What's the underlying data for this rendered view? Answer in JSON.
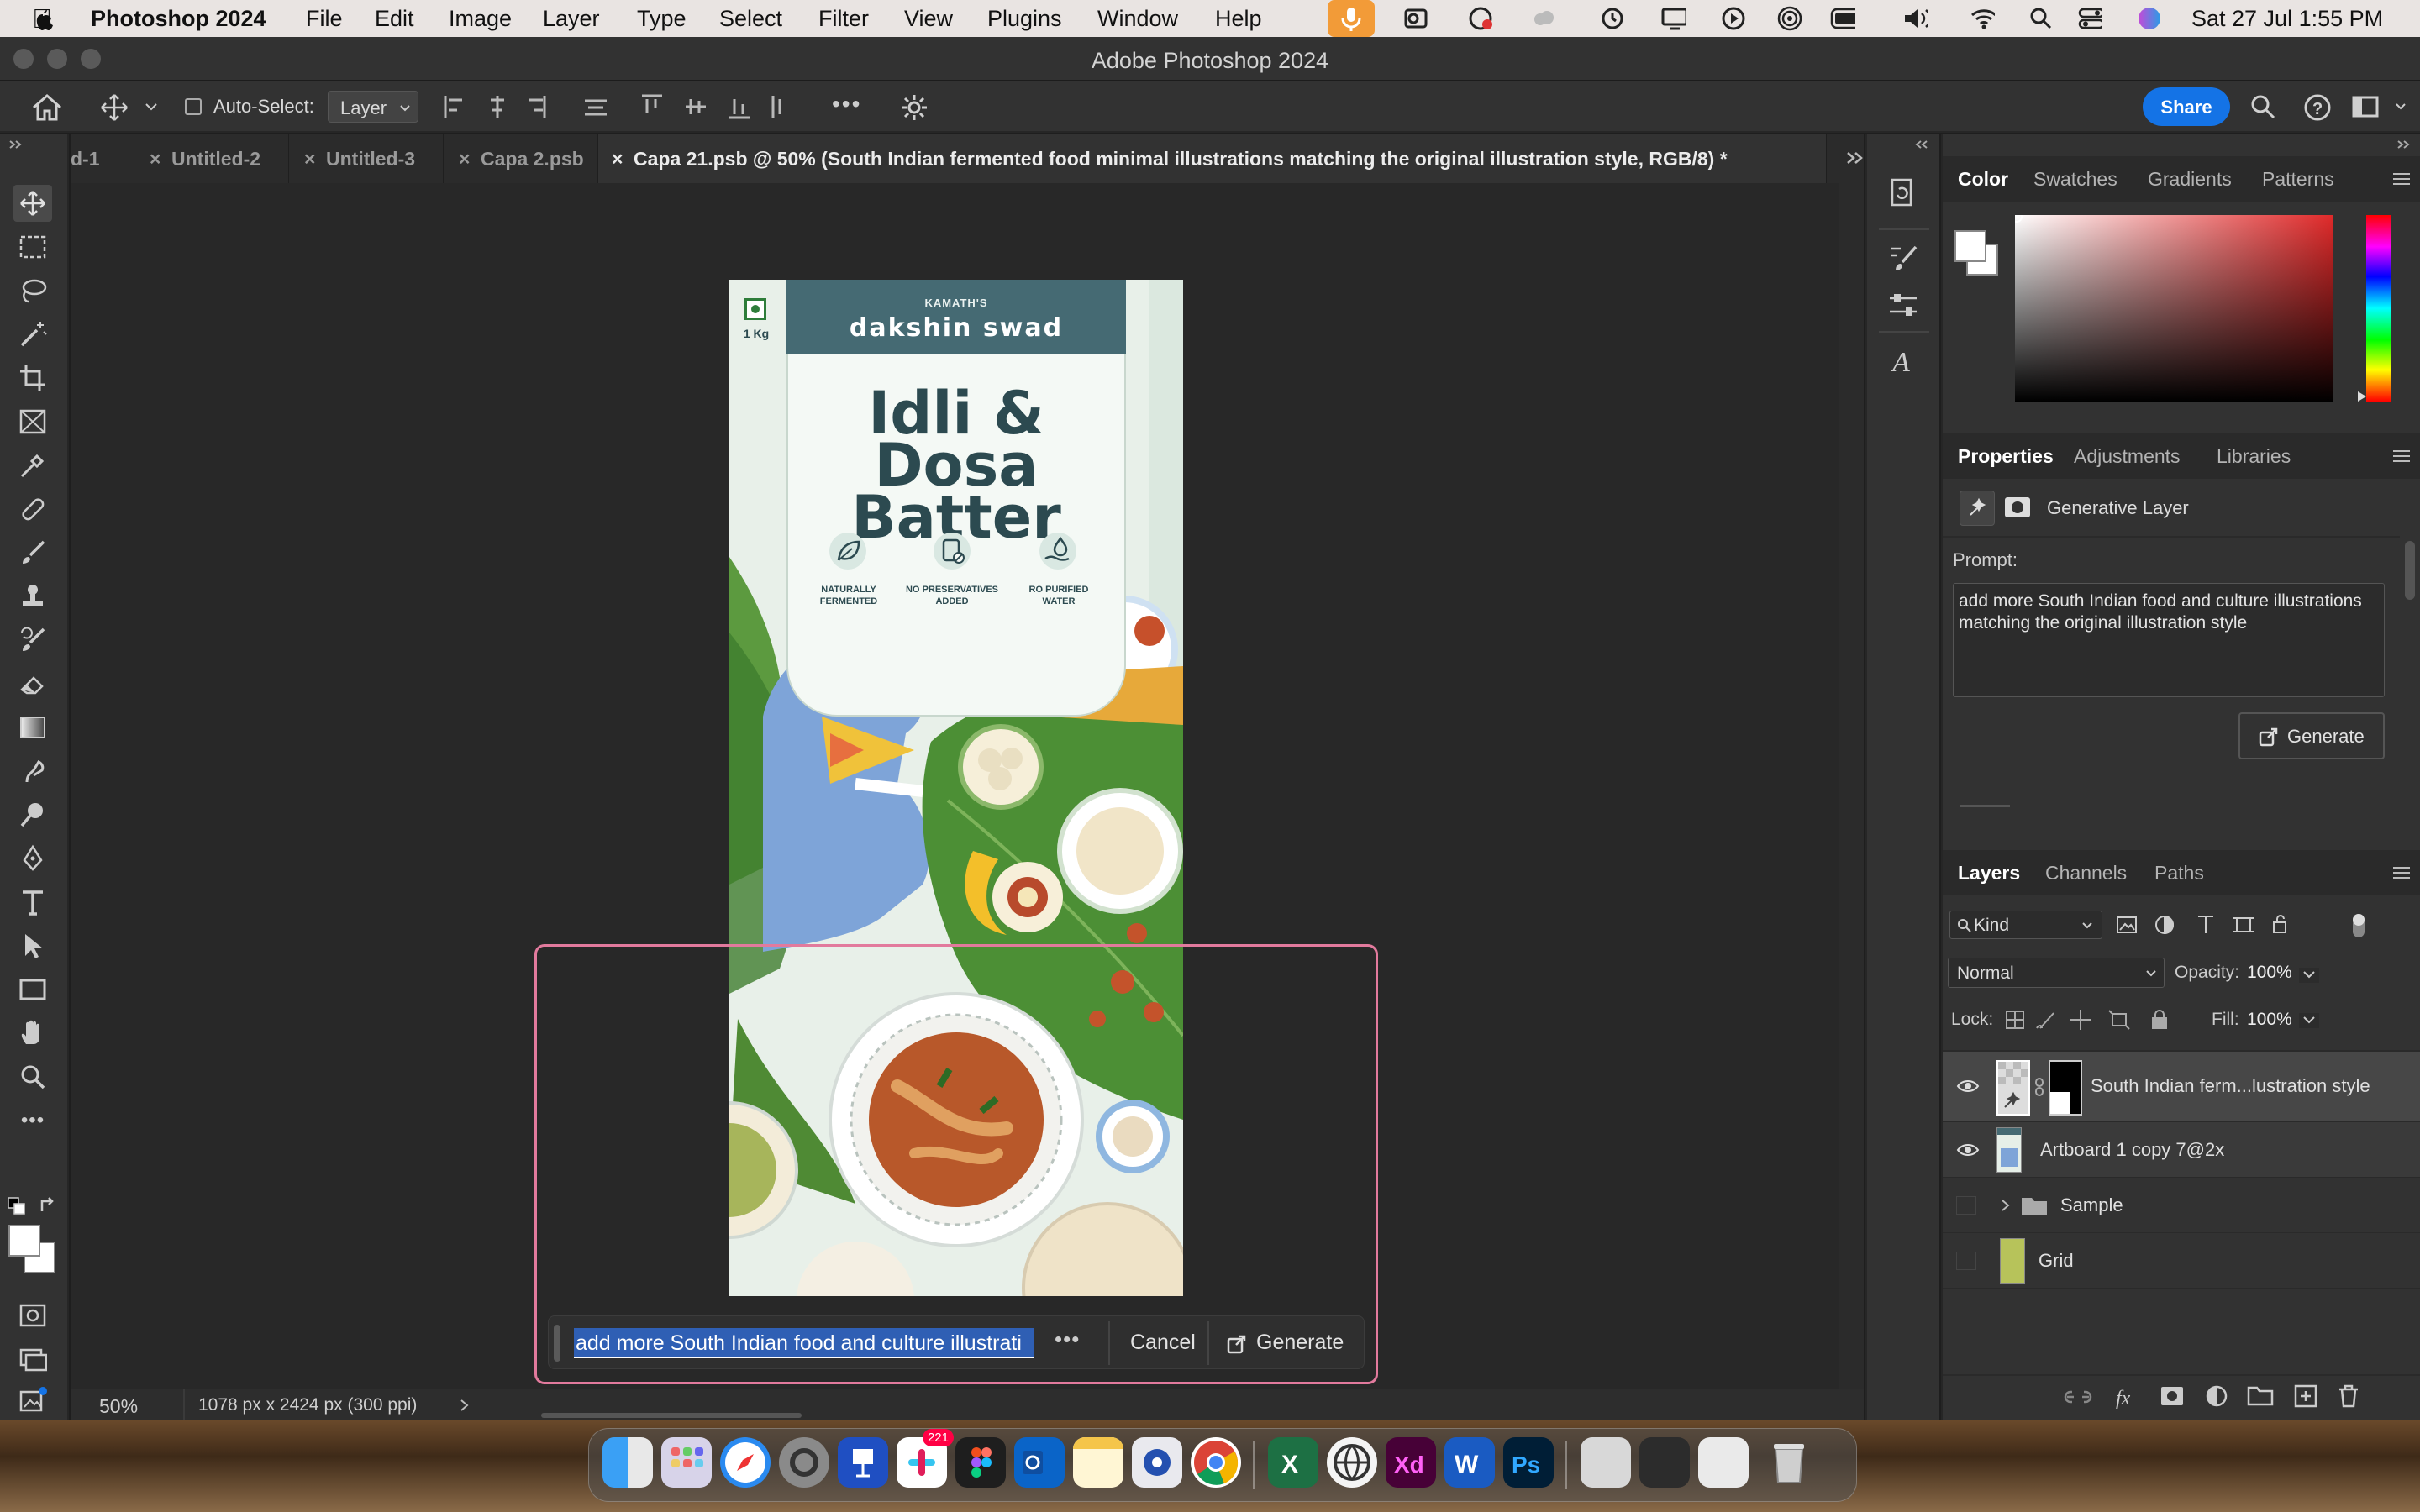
{
  "menubar": {
    "app_name": "Photoshop 2024",
    "items": [
      "File",
      "Edit",
      "Image",
      "Layer",
      "Type",
      "Select",
      "Filter",
      "View",
      "Plugins",
      "Window",
      "Help"
    ],
    "clock": "Sat 27 Jul  1:55 PM"
  },
  "window": {
    "title": "Adobe Photoshop 2024"
  },
  "options_bar": {
    "auto_select_label": "Auto-Select:",
    "auto_select_value": "Layer",
    "share_label": "Share"
  },
  "tabs": [
    {
      "label": "d-1"
    },
    {
      "label": "Untitled-2"
    },
    {
      "label": "Untitled-3"
    },
    {
      "label": "Capa 2.psb"
    },
    {
      "label": "Capa 21.psb @ 50% (South Indian fermented food minimal illustrations matching the original illustration style, RGB/8) *"
    }
  ],
  "artboard": {
    "brand_small": "KAMATH'S",
    "brand": "dakshin swad",
    "weight": "1 Kg",
    "title_line1": "Idli & Dosa",
    "title_line2": "Batter",
    "features": [
      {
        "line1": "NATURALLY",
        "line2": "FERMENTED"
      },
      {
        "line1": "NO PRESERVATIVES",
        "line2": "ADDED"
      },
      {
        "line1": "RO PURIFIED",
        "line2": "WATER"
      }
    ]
  },
  "genfill": {
    "prompt_value": "add more South Indian food and culture illustrati",
    "cancel_label": "Cancel",
    "generate_label": "Generate"
  },
  "status": {
    "zoom": "50%",
    "doc_info": "1078 px x 2424 px (300 ppi)"
  },
  "color_panel": {
    "tabs": [
      "Color",
      "Swatches",
      "Gradients",
      "Patterns"
    ]
  },
  "properties_panel": {
    "tabs": [
      "Properties",
      "Adjustments",
      "Libraries"
    ],
    "layer_type": "Generative Layer",
    "prompt_label": "Prompt:",
    "prompt_text": "add more South Indian food and culture illustrations matching the original illustration style",
    "generate_label": "Generate"
  },
  "layers_panel": {
    "tabs": [
      "Layers",
      "Channels",
      "Paths"
    ],
    "filter": "Kind",
    "blend_mode": "Normal",
    "opacity_label": "Opacity:",
    "opacity": "100%",
    "lock_label": "Lock:",
    "fill_label": "Fill:",
    "fill": "100%",
    "layers": [
      {
        "name": "South Indian ferm...lustration style",
        "visible": true
      },
      {
        "name": "Artboard 1 copy 7@2x",
        "visible": true
      },
      {
        "name": "Sample",
        "visible": false
      },
      {
        "name": "Grid",
        "visible": false
      }
    ]
  },
  "dock": {
    "badge": "221"
  },
  "colors": {
    "accent": "#1473e6",
    "selection": "#2f5fb4",
    "genfill_border": "#e27a9d",
    "package_header": "#456a73"
  }
}
